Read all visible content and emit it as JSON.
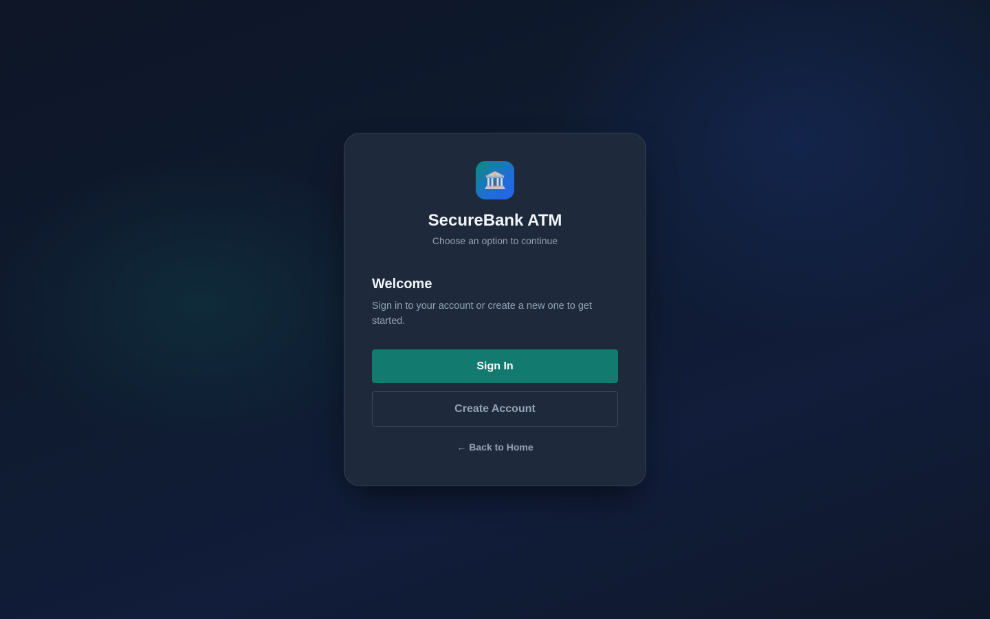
{
  "brand": {
    "icon": "bank-icon",
    "title": "SecureBank ATM",
    "subtitle": "Choose an option to continue"
  },
  "welcome": {
    "title": "Welcome",
    "text": "Sign in to your account or create a new one to get started."
  },
  "actions": {
    "sign_in_label": "Sign In",
    "create_account_label": "Create Account",
    "back_label": "← Back to Home"
  },
  "colors": {
    "primary": "#127a6e",
    "card": "#1e293b",
    "text_muted": "#94a3b8"
  }
}
